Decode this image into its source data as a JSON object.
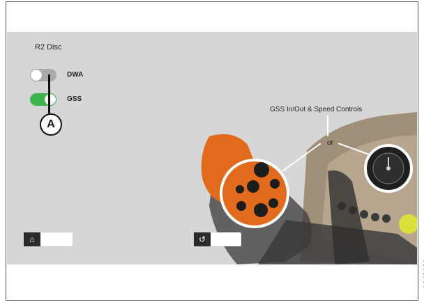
{
  "screen": {
    "section_title": "R2 Disc",
    "toggles": [
      {
        "label": "DWA",
        "state": "off"
      },
      {
        "label": "GSS",
        "state": "on"
      }
    ],
    "diagram_title": "GSS In/Out & Speed Controls",
    "or_label": "or",
    "home_icon": "home-icon",
    "back_icon": "back-icon"
  },
  "callout": {
    "label": "A"
  },
  "figure_id": "1042160",
  "colors": {
    "toggle_on": "#3db44b",
    "toggle_off": "#aaaaaa",
    "orange": "#e26a1d",
    "screen_bg": "#d6d6d6"
  }
}
